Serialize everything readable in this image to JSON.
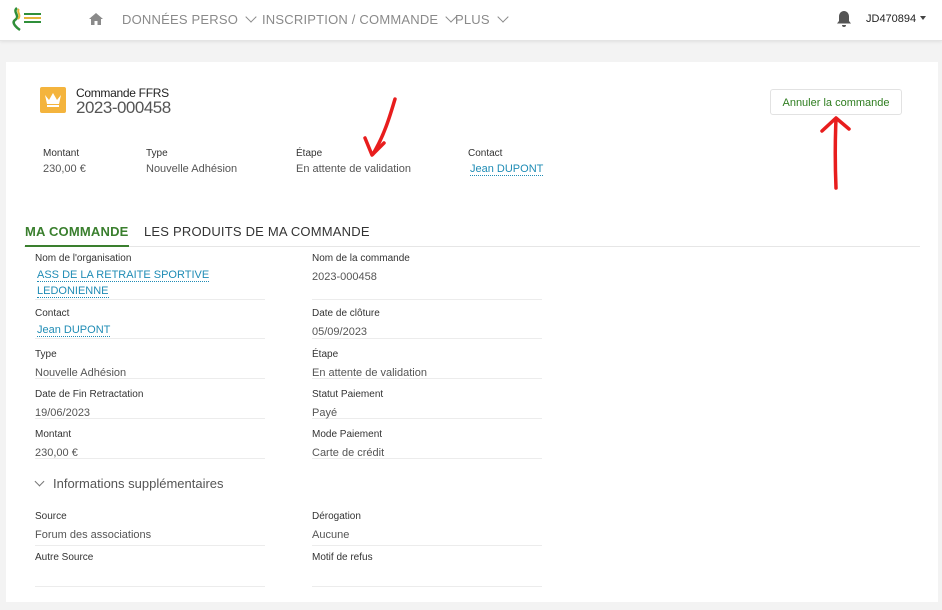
{
  "nav": {
    "items": [
      {
        "label": "DONNÉES PERSO"
      },
      {
        "label": "INSCRIPTION / COMMANDE"
      },
      {
        "label": "PLUS"
      }
    ],
    "user": "JD470894"
  },
  "header": {
    "object_type": "Commande FFRS",
    "order_number": "2023-000458",
    "cancel_button": "Annuler la commande",
    "fields": [
      {
        "label": "Montant",
        "value": "230,00 €"
      },
      {
        "label": "Type",
        "value": "Nouvelle Adhésion"
      },
      {
        "label": "Étape",
        "value": "En attente de validation"
      },
      {
        "label": "Contact",
        "value": "Jean DUPONT"
      }
    ]
  },
  "tabs": [
    {
      "label": "MA COMMANDE",
      "active": true
    },
    {
      "label": "LES PRODUITS DE MA COMMANDE",
      "active": false
    }
  ],
  "details": {
    "left": [
      {
        "label": "Nom de l'organisation",
        "value": "ASS DE LA RETRAITE SPORTIVE LEDONIENNE"
      },
      {
        "label": "Contact",
        "value": "Jean DUPONT"
      },
      {
        "label": "Type",
        "value": "Nouvelle Adhésion"
      },
      {
        "label": "Date de Fin Retractation",
        "value": "19/06/2023"
      },
      {
        "label": "Montant",
        "value": "230,00 €"
      }
    ],
    "right": [
      {
        "label": "Nom de la commande",
        "value": "2023-000458"
      },
      {
        "label": "Date de clôture",
        "value": "05/09/2023"
      },
      {
        "label": "Étape",
        "value": "En attente de validation"
      },
      {
        "label": "Statut Paiement",
        "value": "Payé"
      },
      {
        "label": "Mode Paiement",
        "value": "Carte de crédit"
      }
    ]
  },
  "additional": {
    "title": "Informations supplémentaires",
    "left": [
      {
        "label": "Source",
        "value": "Forum des associations"
      },
      {
        "label": "Autre Source",
        "value": ""
      }
    ],
    "right": [
      {
        "label": "Dérogation",
        "value": "Aucune"
      },
      {
        "label": "Motif de refus",
        "value": ""
      }
    ]
  },
  "colors": {
    "accent_green": "#3a7f2e",
    "link_blue": "#1f8cb5",
    "badge_orange": "#f4b43d",
    "annotation_red": "#e81d1d"
  }
}
